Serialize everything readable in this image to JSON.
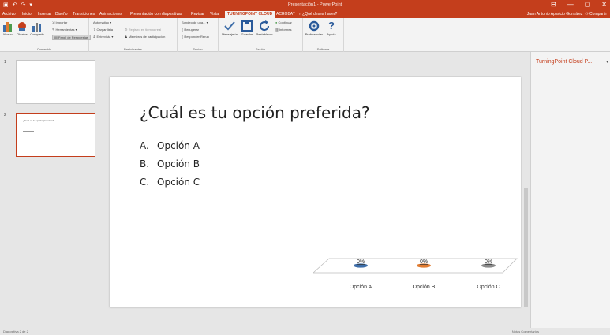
{
  "window": {
    "title": "Presentación1 - PowerPoint",
    "controls": [
      "⊟",
      "—",
      "▢",
      "✕"
    ]
  },
  "quick_access": {
    "save_icon": "save-icon",
    "undo_icon": "undo-icon"
  },
  "tabs": [
    {
      "label": "Archivo"
    },
    {
      "label": "Inicio"
    },
    {
      "label": "Insertar"
    },
    {
      "label": "Diseño"
    },
    {
      "label": "Transiciones"
    },
    {
      "label": "Animaciones"
    },
    {
      "label": "Presentación con diapositivas"
    },
    {
      "label": "Revisar"
    },
    {
      "label": "Vista"
    },
    {
      "label": "TURNINGPOINT CLOUD"
    },
    {
      "label": "ACROBAT"
    },
    {
      "label": "♀ ¿Qué desea hacer?"
    }
  ],
  "user": {
    "name": "Juan Antonio Aparicio González",
    "share": "Compartir"
  },
  "ribbon": {
    "groups": [
      {
        "label": "Contenido",
        "buttons": [
          "Nuevo",
          "Objetos",
          "Compartir"
        ],
        "small": [
          "Importar",
          "Herramientas",
          "Panel de Respuestas"
        ]
      },
      {
        "label": "Participantes",
        "small": [
          "Automático",
          "Cargar lista",
          "Registro en tiempo real",
          "Entrevista",
          "Miembros de participación"
        ]
      },
      {
        "label": "Sesión",
        "small": [
          "Sondeo de una...",
          "Recuperar",
          "Responder/Rerun"
        ]
      },
      {
        "label": "Sesión",
        "buttons": [
          "Mensajería",
          "Guardar",
          "Restablecer"
        ],
        "small": [
          "Continuar",
          "Informes"
        ]
      },
      {
        "label": "Software",
        "buttons": [
          "Preferencias",
          "Ayuda"
        ]
      }
    ]
  },
  "thumbnails": [
    {
      "number": "1"
    },
    {
      "number": "2",
      "caption": "¿Cuál es tu opción preferida?"
    }
  ],
  "slide": {
    "title": "¿Cuál es tu opción preferida?",
    "options": [
      {
        "letter": "A.",
        "text": "Opción A"
      },
      {
        "letter": "B.",
        "text": "Opción B"
      },
      {
        "letter": "C.",
        "text": "Opción C"
      }
    ]
  },
  "chart_data": {
    "type": "bar",
    "categories": [
      "Opción A",
      "Opción B",
      "Opción C"
    ],
    "values": [
      0,
      0,
      0
    ],
    "data_labels": [
      "0%",
      "0%",
      "0%"
    ],
    "colors": [
      "#3e6ea9",
      "#e07b30",
      "#8a8a8a"
    ]
  },
  "task_pane": {
    "title": "TurningPoint Cloud P...",
    "close": "▾"
  },
  "status": {
    "left": "Diapositiva 2 de 2",
    "right": "Notas   Comentarios"
  }
}
